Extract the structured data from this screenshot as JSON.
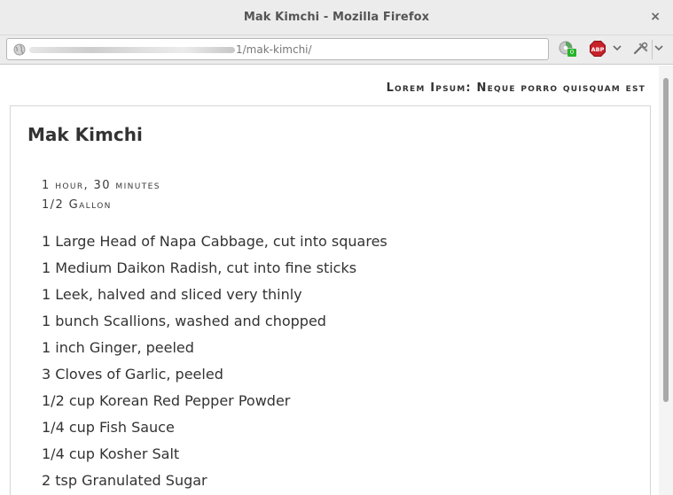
{
  "window": {
    "title": "Mak Kimchi - Mozilla Firefox",
    "close_glyph": "×"
  },
  "navbar": {
    "url_path": "1/mak-kimchi/",
    "extension_badge": "0",
    "icons": [
      "globe-icon",
      "extension-icon",
      "adblock-plus-icon",
      "chevron-down-icon",
      "tools-icon",
      "chevron-down-icon"
    ]
  },
  "page": {
    "site_title": "Lorem Ipsum: Neque porro quisquam est",
    "recipe": {
      "title": "Mak Kimchi",
      "time": "1 hour, 30 minutes",
      "yield": "1/2 Gallon",
      "ingredients": [
        "1 Large Head of Napa Cabbage, cut into squares",
        "1 Medium Daikon Radish, cut into fine sticks",
        "1 Leek, halved and sliced very thinly",
        "1 bunch Scallions, washed and chopped",
        "1 inch Ginger, peeled",
        "3 Cloves of Garlic, peeled",
        "1/2 cup Korean Red Pepper Powder",
        "1/4 cup Fish Sauce",
        "1/4 cup Kosher Salt",
        "2 tsp Granulated Sugar"
      ]
    }
  },
  "colors": {
    "chrome_bg": "#ececec",
    "badge_green": "#27b42a",
    "abp_red": "#c8222a"
  }
}
